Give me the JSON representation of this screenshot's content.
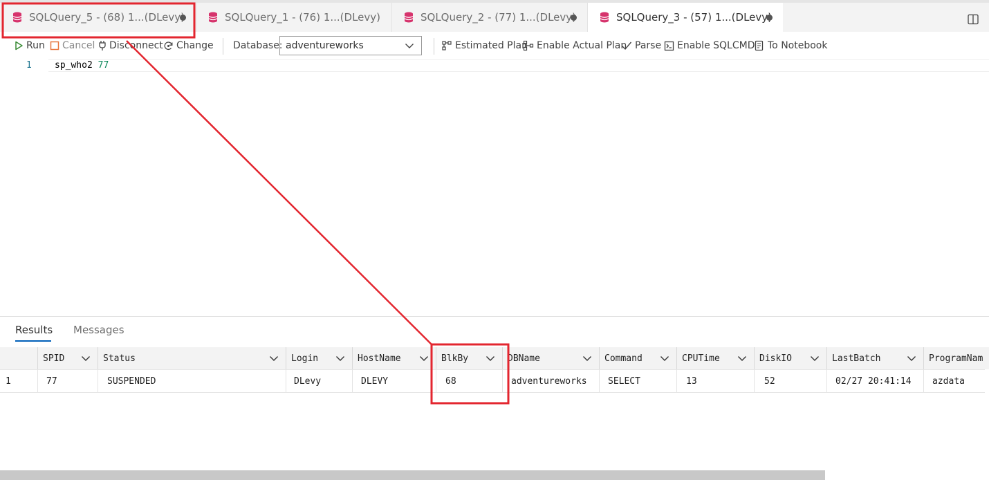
{
  "tabs": [
    {
      "label": "SQLQuery_5 - (68) 1...(DLevy)",
      "dirty": true,
      "active": false
    },
    {
      "label": "SQLQuery_1 - (76) 1...(DLevy)",
      "dirty": false,
      "active": false
    },
    {
      "label": "SQLQuery_2 - (77) 1...(DLevy)",
      "dirty": true,
      "active": false
    },
    {
      "label": "SQLQuery_3 - (57) 1...(DLevy)",
      "dirty": true,
      "active": true
    }
  ],
  "toolbar": {
    "run": "Run",
    "cancel": "Cancel",
    "disconnect": "Disconnect",
    "change": "Change",
    "database_label": "Database:",
    "database_value": "adventureworks",
    "estimated_plan": "Estimated Plan",
    "actual_plan": "Enable Actual Plan",
    "parse": "Parse",
    "sqlcmd": "Enable SQLCMD",
    "notebook": "To Notebook"
  },
  "editor": {
    "line_number": "1",
    "code_keyword": "sp_who2 ",
    "code_number": "77"
  },
  "results_panel": {
    "tabs": [
      "Results",
      "Messages"
    ]
  },
  "grid": {
    "columns": [
      "SPID",
      "Status",
      "Login",
      "HostName",
      "BlkBy",
      "DBName",
      "Command",
      "CPUTime",
      "DiskIO",
      "LastBatch",
      "ProgramNam"
    ],
    "rows": [
      {
        "num": "1",
        "cells": [
          "77",
          "SUSPENDED",
          "DLevy",
          "DLEVY",
          "68",
          "adventureworks",
          "SELECT",
          "13",
          "52",
          "02/27 20:41:14",
          "azdata"
        ]
      }
    ]
  },
  "colors": {
    "annotation_red": "#e3262f",
    "db_icon": "#d6336c",
    "run_green": "#388a34",
    "cancel_orange": "#e8743b",
    "active_tab_underline": "#005fb8"
  }
}
